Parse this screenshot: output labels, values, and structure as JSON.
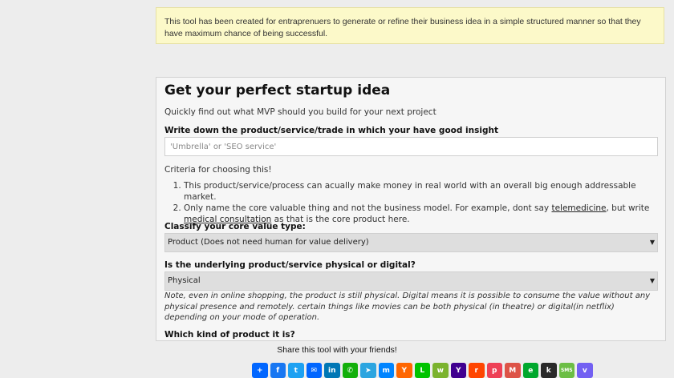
{
  "notice": "This tool has been created for entraprenuers to generate or refine their business idea in a simple structured manner so that they have maximum chance of being successful.",
  "form": {
    "title": "Get your perfect startup idea",
    "subtitle": "Quickly find out what MVP should you build for your next project",
    "product_label": "Write down the product/service/trade in which your have good insight",
    "product_placeholder": "'Umbrella' or 'SEO service'",
    "criteria_heading": "Criteria for choosing this!",
    "criteria": {
      "item1": "This product/service/process can acually make money in real world with an overall big enough addressable market.",
      "item2_prefix": "Only name the core valuable thing and not the business model. For example, dont say ",
      "item2_link1": "telemedicine",
      "item2_mid": ", but write ",
      "item2_link2": "medical consultation",
      "item2_suffix": " as that is the core product here."
    },
    "value_type_label": "Classify your core value type:",
    "value_type_selected": "Product (Does not need human for value delivery)",
    "physical_label": "Is the underlying product/service physical or digital?",
    "physical_selected": "Physical",
    "note": "Note, even in online shopping, the product is still physical. Digital means it is possible to consume the value without any physical presence and remotely. certain things like movies can be both physical (in theatre) or digital(in netflix) depending on your mode of operation.",
    "kind_label": "Which kind of product it is?",
    "select_arrow": "▼"
  },
  "share": {
    "text": "Share this tool with your friends!",
    "icons": [
      {
        "name": "addtoany-icon",
        "glyph": "+",
        "color": "#0166ff"
      },
      {
        "name": "facebook-icon",
        "glyph": "f",
        "color": "#1877f2"
      },
      {
        "name": "twitter-icon",
        "glyph": "t",
        "color": "#1da1f2"
      },
      {
        "name": "email-icon",
        "glyph": "✉",
        "color": "#0166ff"
      },
      {
        "name": "linkedin-icon",
        "glyph": "in",
        "color": "#0077b5"
      },
      {
        "name": "whatsapp-icon",
        "glyph": "✆",
        "color": "#12af0a"
      },
      {
        "name": "telegram-icon",
        "glyph": "➤",
        "color": "#2ca5e0"
      },
      {
        "name": "messenger-icon",
        "glyph": "m",
        "color": "#0084ff"
      },
      {
        "name": "hackernews-icon",
        "glyph": "Y",
        "color": "#ff6600"
      },
      {
        "name": "line-icon",
        "glyph": "L",
        "color": "#00c300"
      },
      {
        "name": "wechat-icon",
        "glyph": "w",
        "color": "#7bb32e"
      },
      {
        "name": "yahoo-icon",
        "glyph": "Y",
        "color": "#400090"
      },
      {
        "name": "reddit-icon",
        "glyph": "r",
        "color": "#ff4500"
      },
      {
        "name": "pocket-icon",
        "glyph": "p",
        "color": "#ee4056"
      },
      {
        "name": "gmail-icon",
        "glyph": "M",
        "color": "#dd5347"
      },
      {
        "name": "evernote-icon",
        "glyph": "e",
        "color": "#00a82d"
      },
      {
        "name": "kik-icon",
        "glyph": "k",
        "color": "#2a2a2a"
      },
      {
        "name": "sms-icon",
        "glyph": "SMS",
        "color": "#6cbe45"
      },
      {
        "name": "viber-icon",
        "glyph": "v",
        "color": "#7360f2"
      }
    ]
  }
}
